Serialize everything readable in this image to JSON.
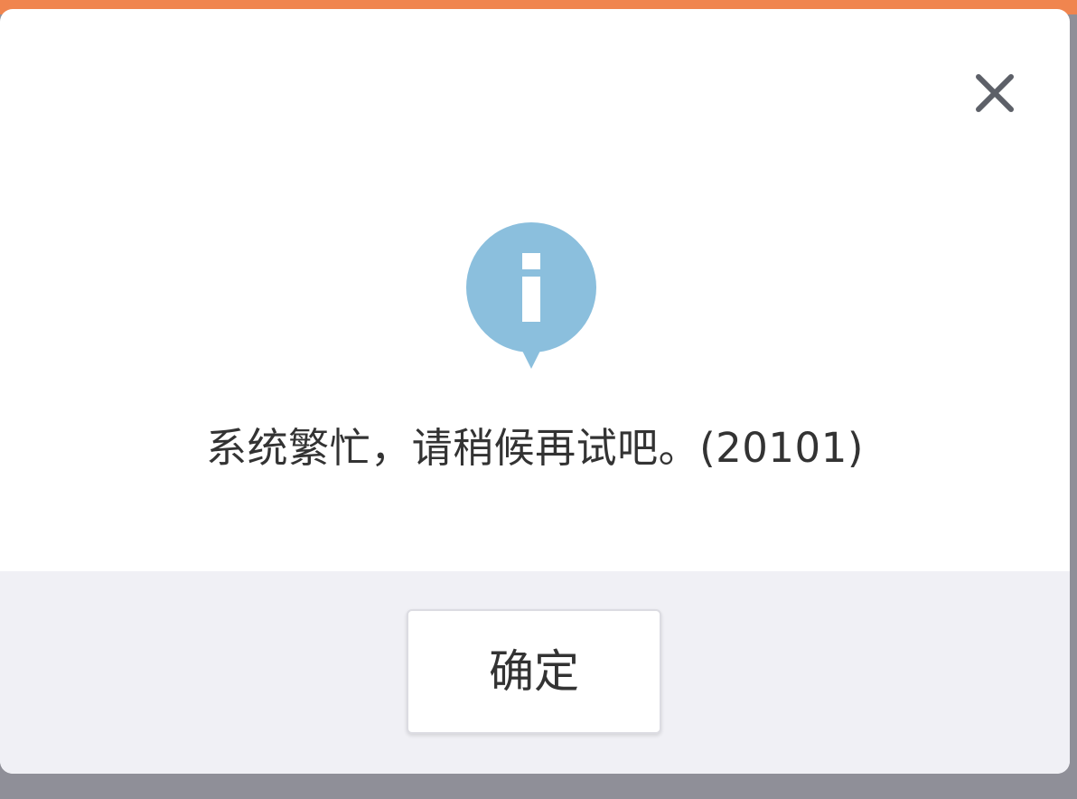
{
  "dialog": {
    "message": "系统繁忙，请稍候再试吧。(20101)",
    "close_icon": "close-icon",
    "info_icon": "info-icon",
    "confirm_label": "确定"
  },
  "colors": {
    "accent_stripe": "#f0854f",
    "info_icon": "#8bbfdd",
    "footer_background": "#f0f0f5",
    "backdrop": "#8f8f98"
  }
}
